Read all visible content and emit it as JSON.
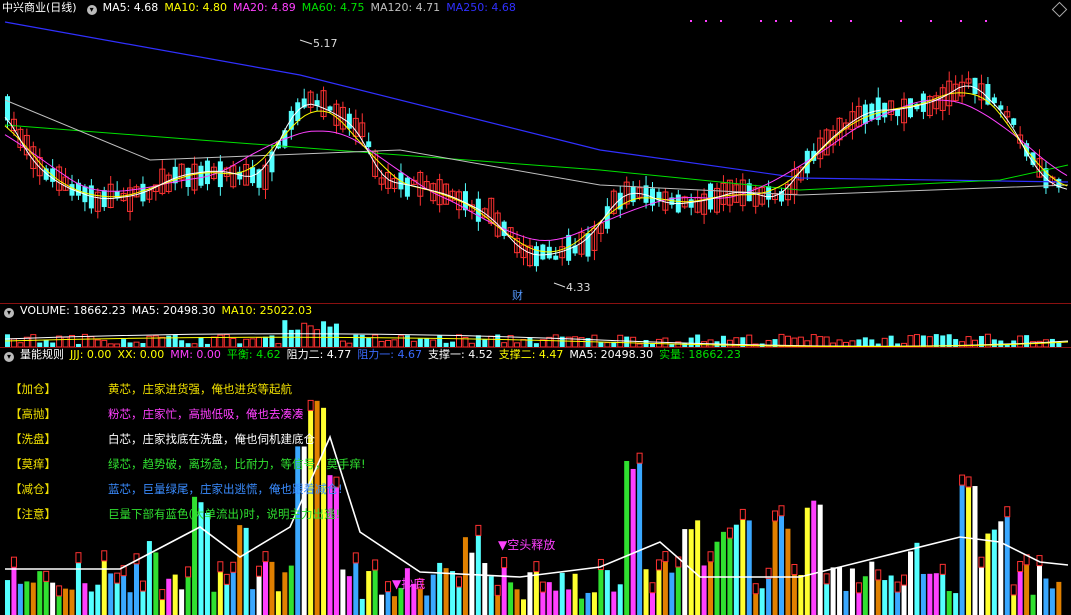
{
  "price_header": {
    "name": "中兴商业(日线)",
    "ma5": "MA5: 4.68",
    "ma10": "MA10: 4.80",
    "ma20": "MA20: 4.89",
    "ma60": "MA60: 4.75",
    "ma120": "MA120: 4.71",
    "ma250": "MA250: 4.68"
  },
  "price_annotations": {
    "high": "5.17",
    "low": "4.33",
    "event": "财"
  },
  "volume_header": {
    "volume": "VOLUME: 18662.23",
    "ma5": "MA5: 20498.30",
    "ma10": "MA10: 25022.03"
  },
  "indicator_header": {
    "name": "量能规则",
    "jjj": "JJJ: 0.00",
    "xx": "XX: 0.00",
    "mm": "MM: 0.00",
    "pingheng": "平衡: 4.62",
    "zuli2": "阻力二: 4.77",
    "zuli1": "阻力一: 4.67",
    "zhicheng1": "支撑一: 4.52",
    "zhicheng2": "支撑二: 4.47",
    "ma5": "MA5: 20498.30",
    "shiliang": "实量: 18662.23"
  },
  "indicator_legend": [
    {
      "tag": "【加仓】",
      "text": "黄芯，庄家进货强，俺也进货等起航"
    },
    {
      "tag": "【高抛】",
      "text": "粉芯，庄家忙，高抛低吸，俺也去凑凑"
    },
    {
      "tag": "【洗盘】",
      "text": "白芯，庄家找底在洗盘，俺也伺机建底仓"
    },
    {
      "tag": "【莫痒】",
      "text": "绿芯，趋势破，离场急，比耐力，等信号，莫手痒!"
    },
    {
      "tag": "【减仓】",
      "text": "蓝芯，巨量绿尾，庄家出逃慌，俺也跟着减仓!"
    },
    {
      "tag": "【注意】",
      "text": "巨量下部有蓝色(大单流出)时，说明主力出逃!"
    }
  ],
  "indicator_annotations": {
    "short_release": "▼空头释放",
    "bottom_label": "▼抄底"
  },
  "colors": {
    "up": "#ff3232",
    "down": "#54ffff",
    "ma5": "#ffffff",
    "ma10": "#ffff00",
    "ma20": "#ff40ff",
    "ma60": "#00e000",
    "ma120": "#c0c0c0",
    "ma250": "#3030ff",
    "separator": "#8a1010"
  }
}
